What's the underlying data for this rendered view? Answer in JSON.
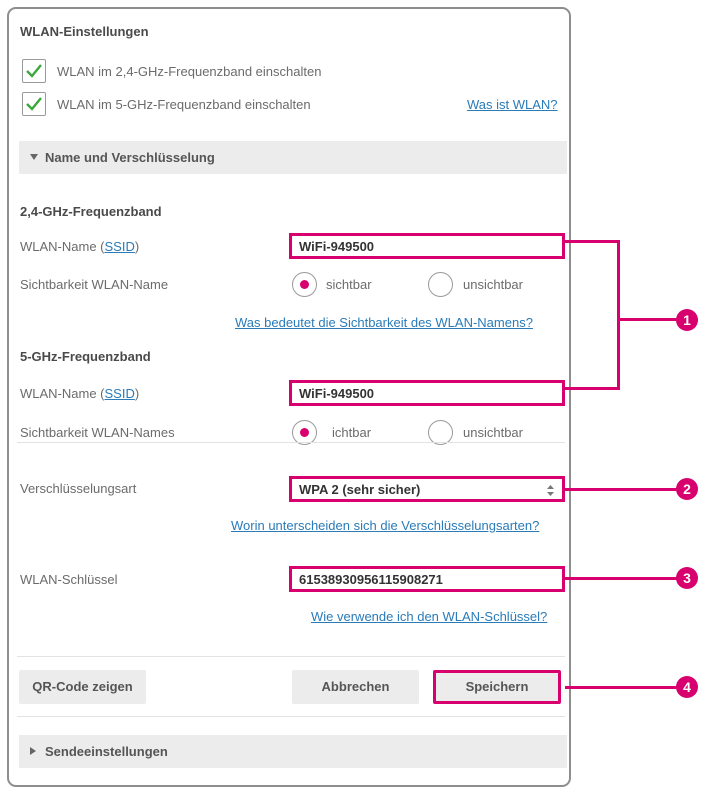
{
  "wlan": {
    "heading": "WLAN-Einstellungen",
    "band24_checkbox_label": "WLAN im 2,4-GHz-Frequenzband einschalten",
    "band5_checkbox_label": "WLAN im 5-GHz-Frequenzband einschalten",
    "what_is_wlan_link": "Was ist WLAN?"
  },
  "name_section": {
    "bar_label": "Name und Verschlüsselung"
  },
  "band24": {
    "heading": "2,4-GHz-Frequenzband",
    "ssid_label_prefix": "WLAN-Name  (",
    "ssid_link": "SSID",
    "ssid_label_suffix": ")",
    "ssid_value": "WiFi-949500",
    "visibility_label": "Sichtbarkeit WLAN-Name",
    "visible_option": "sichtbar",
    "invisible_option": "unsichtbar",
    "visibility_help_link": "Was bedeutet die Sichtbarkeit des WLAN-Namens?"
  },
  "band5": {
    "heading": "5-GHz-Frequenzband",
    "ssid_label_prefix": "WLAN-Name  (",
    "ssid_link": "SSID",
    "ssid_label_suffix": ")",
    "ssid_value": "WiFi-949500",
    "visibility_label": "Sichtbarkeit WLAN-Names",
    "visible_option": "ichtbar",
    "invisible_option": "unsichtbar"
  },
  "encryption": {
    "label": "Verschlüsselungsart",
    "selected": "WPA 2 (sehr sicher)",
    "help_link": "Worin unterscheiden sich die Verschlüsselungsarten?"
  },
  "key": {
    "label": "WLAN-Schlüssel",
    "value": "61538930956115908271",
    "help_link": "Wie verwende ich den WLAN-Schlüssel?"
  },
  "buttons": {
    "qr": "QR-Code zeigen",
    "cancel": "Abbrechen",
    "save": "Speichern"
  },
  "send_section": {
    "bar_label": "Sendeeinstellungen"
  },
  "callouts": {
    "one": "1",
    "two": "2",
    "three": "3",
    "four": "4"
  },
  "colors": {
    "accent": "#d8006f",
    "link": "#2a7bb8",
    "check": "#3aa83a"
  }
}
